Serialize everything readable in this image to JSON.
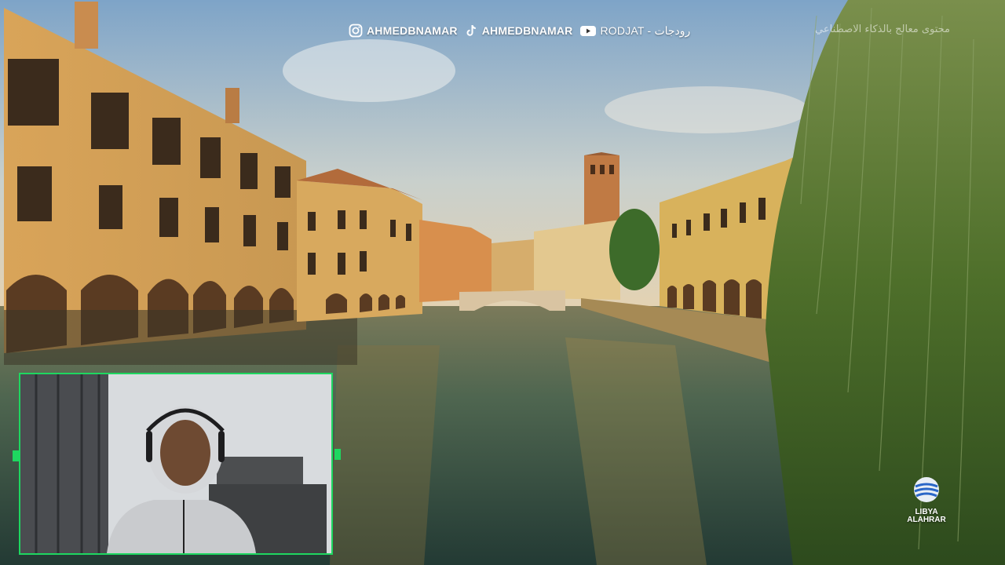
{
  "overlay": {
    "socials": [
      {
        "icon": "instagram-icon",
        "handle": "AHMEDBNAMAR"
      },
      {
        "icon": "tiktok-icon",
        "handle": "AHMEDBNAMAR"
      },
      {
        "icon": "youtube-icon",
        "handle": "RODJAT - رودجات"
      }
    ],
    "top_right_caption": "محتوى معالج بالذكاء الاصطناعي",
    "brand_watermark": {
      "icon": "globe-icon",
      "line1": "LIBYA",
      "line2": "ALAHRAR"
    }
  },
  "webcam": {
    "border_color": "#1ed760"
  },
  "colors": {
    "sky": "#8fb1cf",
    "buildings": "#d9a65a",
    "water": "#3f5a48",
    "willow": "#4e7a2e"
  }
}
